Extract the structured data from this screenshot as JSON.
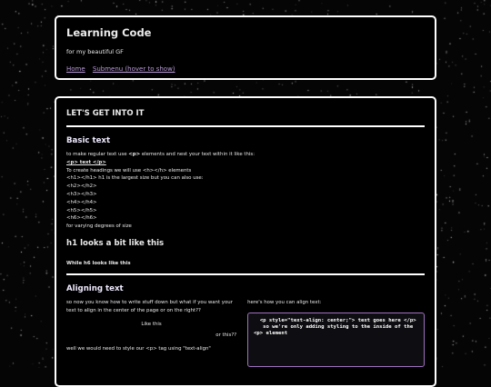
{
  "header": {
    "title": "Learning Code",
    "subtitle": "for my beautiful GF",
    "nav": [
      "Home",
      "Submenu (hover to show)"
    ]
  },
  "main": {
    "section_title": "LET'S GET INTO IT",
    "basic": {
      "heading": "Basic text",
      "intro_before": "to make regular text use ",
      "intro_tag": "<p>",
      "intro_after": " elements and nest your text within it like this:",
      "example": "<p> text </p>",
      "headings_line": "To create headings we will use <h></h> elements",
      "h1_line": "<h1></h1> h1 is the largest size but you can also use:",
      "tags": [
        "<h2></h2>",
        "<h3></h3>",
        "<h4></h4>",
        "<h5></h5>",
        "<h6></h6>"
      ],
      "degrees": "for varying degrees of size",
      "h1_demo": "h1 looks a bit like this",
      "h6_demo": "While h6 looks like this"
    },
    "align": {
      "heading": "Aligning text",
      "intro": "so now you know how to write stuff down but what if you want your text to align in the center of the page or on the right??",
      "center_demo": "Like this",
      "right_demo": "or this??",
      "style_line": "well we would need to style our <p> tag using \"text-align\"",
      "right_intro": "here's how you can align text:",
      "code": "  <p style=\"text-align: center;\"> text goes here </p>\n   so we're only adding styling to the inside of the <p> element"
    }
  }
}
